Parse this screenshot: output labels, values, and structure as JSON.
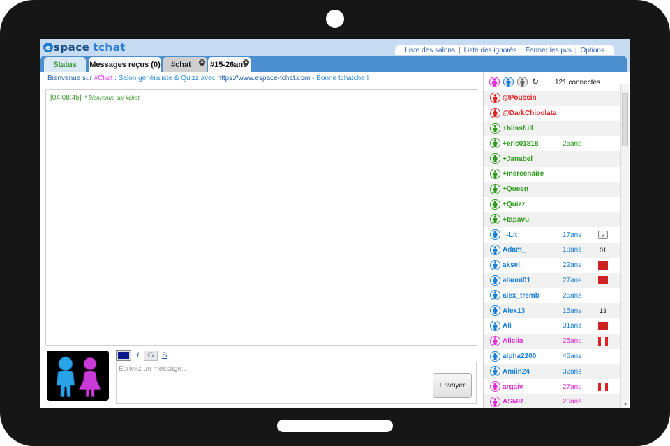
{
  "colors": {
    "moderator": "#e02424",
    "voiced": "#2e9a1e",
    "male": "#1a7fd6",
    "female": "#e02bd6"
  },
  "header": {
    "logo_e": "e",
    "logo_word1": "space",
    "logo_word2": "tchat",
    "links": [
      "Liste des salons",
      "Liste des ignorés",
      "Fermer les pvs",
      "Options"
    ]
  },
  "tabs": {
    "status": "Status",
    "messages": "Messages reçus (0)",
    "chat": "#chat",
    "room": "#15-26ans",
    "close_icon": "x-icon"
  },
  "welcome": {
    "prefix": "Bienvenue sur ",
    "room": "#Chat",
    "rest": " : Salon généraliste & Quizz avec ",
    "url": "https://www.espace-tchat.com",
    "suffix": " - Bonne tchatche !"
  },
  "chat_messages": [
    {
      "time": "[04:08:45]",
      "text": "* Bienvenue sur #chat"
    }
  ],
  "toolbar": {
    "italic": "I",
    "bold": "G",
    "underline": "S",
    "text_color": "#0a1a8c"
  },
  "input": {
    "placeholder": "Écrivez un message...",
    "send_label": "Envoyer"
  },
  "userpanel": {
    "count_label": "121 connectés"
  },
  "users": [
    {
      "name": "@Poussin",
      "age": "",
      "type": "moderator",
      "extra": ""
    },
    {
      "name": "@DarkChipolata",
      "age": "",
      "type": "moderator",
      "extra": ""
    },
    {
      "name": "+blissfull",
      "age": "",
      "type": "voiced",
      "extra": ""
    },
    {
      "name": "+eric01818",
      "age": "25ans",
      "type": "voiced",
      "extra": ""
    },
    {
      "name": "+Janabel",
      "age": "",
      "type": "voiced",
      "extra": ""
    },
    {
      "name": "+mercenaire",
      "age": "",
      "type": "voiced",
      "extra": ""
    },
    {
      "name": "+Queen",
      "age": "",
      "type": "voiced",
      "extra": ""
    },
    {
      "name": "+Quizz",
      "age": "",
      "type": "voiced",
      "extra": ""
    },
    {
      "name": "+tapavu",
      "age": "",
      "type": "voiced",
      "extra": ""
    },
    {
      "name": "_-Lit",
      "age": "17ans",
      "type": "male",
      "extra": "?",
      "flag": "unknown"
    },
    {
      "name": "Adam_",
      "age": "18ans",
      "type": "male",
      "extra": "01"
    },
    {
      "name": "aksel",
      "age": "22ans",
      "type": "male",
      "extra": "",
      "flag": "red"
    },
    {
      "name": "alaoui01",
      "age": "27ans",
      "type": "male",
      "extra": "",
      "flag": "red"
    },
    {
      "name": "alex_tremb",
      "age": "25ans",
      "type": "male",
      "extra": ""
    },
    {
      "name": "Alex13",
      "age": "15ans",
      "type": "male",
      "extra": "13"
    },
    {
      "name": "Ali",
      "age": "31ans",
      "type": "male",
      "extra": "",
      "flag": "red"
    },
    {
      "name": "Aliciia",
      "age": "25ans",
      "type": "female",
      "extra": "",
      "flag": "ca"
    },
    {
      "name": "alpha2200",
      "age": "45ans",
      "type": "male",
      "extra": ""
    },
    {
      "name": "Amiin24",
      "age": "32ans",
      "type": "male",
      "extra": ""
    },
    {
      "name": "argaiv",
      "age": "27ans",
      "type": "female",
      "extra": "",
      "flag": "ca"
    },
    {
      "name": "ASMR",
      "age": "20ans",
      "type": "female",
      "extra": ""
    }
  ]
}
